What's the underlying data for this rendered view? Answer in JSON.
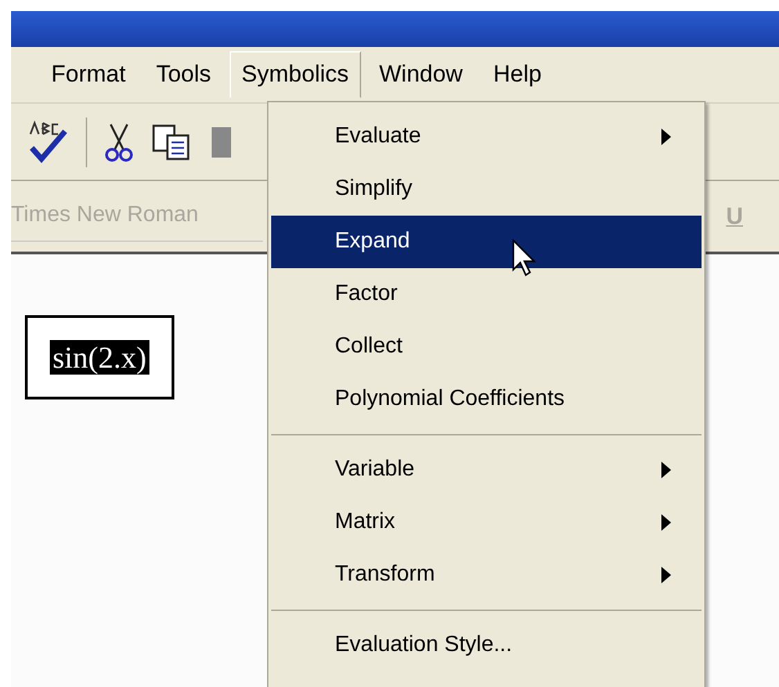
{
  "menu_bar": [
    {
      "label": "Format",
      "selected": false
    },
    {
      "label": "Tools",
      "selected": false
    },
    {
      "label": "Symbolics",
      "selected": true
    },
    {
      "label": "Window",
      "selected": false
    },
    {
      "label": "Help",
      "selected": false
    }
  ],
  "format_bar": {
    "font": "Times New Roman",
    "font_disabled": true,
    "underline": "U"
  },
  "document": {
    "expression": "sin(2.x)",
    "expression_selected": true
  },
  "dropdown": {
    "groups": [
      [
        {
          "label": "Evaluate",
          "submenu": true,
          "selected": false
        },
        {
          "label": "Simplify",
          "submenu": false,
          "selected": false
        },
        {
          "label": "Expand",
          "submenu": false,
          "selected": true
        },
        {
          "label": "Factor",
          "submenu": false,
          "selected": false
        },
        {
          "label": "Collect",
          "submenu": false,
          "selected": false
        },
        {
          "label": "Polynomial Coefficients",
          "submenu": false,
          "selected": false
        }
      ],
      [
        {
          "label": "Variable",
          "submenu": true,
          "selected": false
        },
        {
          "label": "Matrix",
          "submenu": true,
          "selected": false
        },
        {
          "label": "Transform",
          "submenu": true,
          "selected": false
        }
      ],
      [
        {
          "label": "Evaluation Style...",
          "submenu": false,
          "selected": false
        }
      ]
    ]
  }
}
